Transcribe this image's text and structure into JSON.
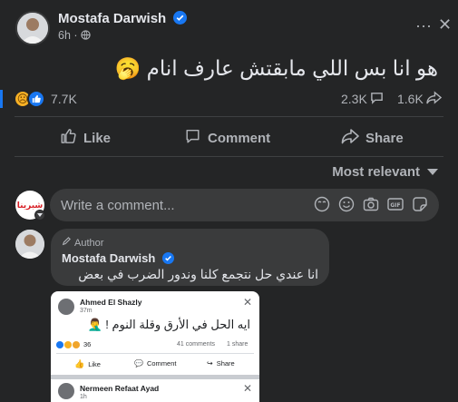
{
  "post": {
    "author": "Mostafa Darwish",
    "time": "6h",
    "privacy_icon": "globe-icon",
    "text": "هو انا بس اللي مابقتش عارف انام 🥱"
  },
  "reactions": {
    "count": "7.7K",
    "comments": "2.3K",
    "shares": "1.6K"
  },
  "actions": {
    "like": "Like",
    "comment": "Comment",
    "share": "Share"
  },
  "comments_sort": "Most relevant",
  "write_comment": {
    "placeholder": "Write a comment...",
    "avatar_text": "شبرينا"
  },
  "comment": {
    "badge": "Author",
    "author": "Mostafa Darwish",
    "text": "انا عندي حل نتجمع كلنا وندور الضرب في بعض"
  },
  "attached_screenshot": {
    "author": "Ahmed El Shazly",
    "time": "37m",
    "text": "ايه الحل في الأرق وقلة النوم ! 🤦‍♂️",
    "reactions": "36",
    "comments": "41 comments",
    "shares": "1 share",
    "like": "Like",
    "comment": "Comment",
    "share": "Share",
    "second_author": "Nermeen Refaat Ayad",
    "second_time": "1h"
  },
  "colors": {
    "background": "#242526",
    "verified": "#1877f2",
    "secondary_text": "#b0b3b8"
  }
}
